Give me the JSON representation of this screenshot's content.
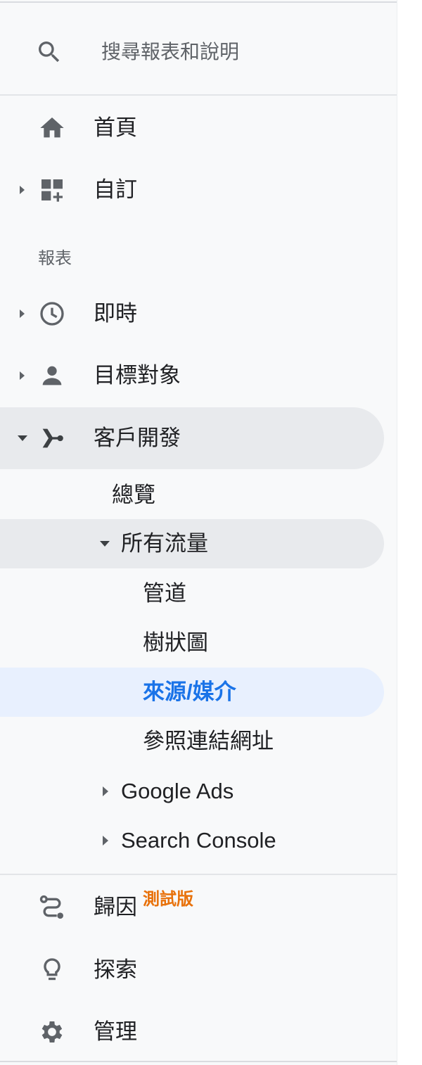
{
  "search": {
    "placeholder": "搜尋報表和說明"
  },
  "nav": {
    "home": "首頁",
    "custom": "自訂",
    "section_reports": "報表",
    "realtime": "即時",
    "audience": "目標對象",
    "acquisition": "客戶開發",
    "acquisition_children": {
      "overview": "總覽",
      "all_traffic": "所有流量",
      "all_traffic_children": {
        "channels": "管道",
        "treemaps": "樹狀圖",
        "source_medium": "來源/媒介",
        "referrals": "參照連結網址"
      },
      "google_ads": "Google Ads",
      "search_console": "Search Console"
    },
    "attribution": "歸因",
    "attribution_badge": "測試版",
    "discover": "探索",
    "admin": "管理"
  },
  "colors": {
    "active_blue": "#1a73e8",
    "active_blue_bg": "#e8f0fe",
    "active_grey_bg": "#e8eaed",
    "beta_orange": "#e8710a",
    "icon_grey": "#5f6368"
  }
}
